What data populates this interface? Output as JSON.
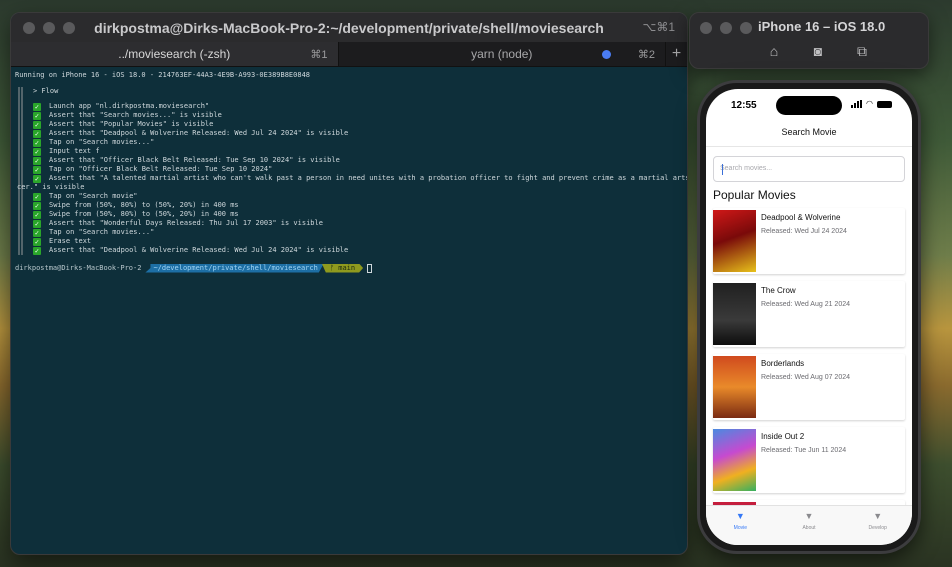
{
  "terminal": {
    "title": "dirkpostma@Dirks-MacBook-Pro-2:~/development/private/shell/moviesearch",
    "shortcut": "⌥⌘1",
    "tabs": [
      {
        "label": "../moviesearch (-zsh)",
        "shortcut": "⌘1"
      },
      {
        "label": "yarn (node)",
        "shortcut": "⌘2"
      }
    ],
    "run_line": "Running on iPhone 16 - iOS 18.0 - 214763EF-44A3-4E9B-A993-0E389B8E0848",
    "flow_header": "> Flow",
    "flow_lines": [
      "Launch app \"nl.dirkpostma.moviesearch\"",
      "Assert that \"Search movies...\" is visible",
      "Assert that \"Popular Movies\" is visible",
      "Assert that \"Deadpool & Wolverine Released: Wed Jul 24 2024\" is visible",
      "Tap on \"Search movies...\"",
      "Input text f",
      "Assert that \"Officer Black Belt Released: Tue Sep 10 2024\" is visible",
      "Tap on \"Officer Black Belt Released: Tue Sep 10 2024\"",
      "Assert that \"A talented martial artist who can't walk past a person in need unites with a probation officer to fight and prevent crime as a martial arts offi",
      "Tap on \"Search movie\"",
      "Swipe from (50%, 80%) to (50%, 20%) in 400 ms",
      "Swipe from (50%, 80%) to (50%, 20%) in 400 ms",
      "Assert that \"Wonderful Days Released: Thu Jul 17 2003\" is visible",
      "Tap on \"Search movies...\"",
      "Erase text",
      "Assert that \"Deadpool & Wolverine Released: Wed Jul 24 2024\" is visible"
    ],
    "wrap_continuation": "cer.\" is visible",
    "prompt": {
      "user": "dirkpostma@Dirks-MacBook-Pro-2",
      "path": "~/development/private/shell/moviesearch",
      "branch": "ᚠ main"
    }
  },
  "simulator": {
    "title": "iPhone 16 – iOS 18.0",
    "icons": [
      "home-icon",
      "screenshot-icon",
      "rotate-icon"
    ]
  },
  "phone": {
    "time": "12:55",
    "nav_title": "Search Movie",
    "search_placeholder": "Search movies...",
    "section_title": "Popular Movies",
    "movies": [
      {
        "title": "Deadpool & Wolverine",
        "date": "Released: Wed Jul 24 2024"
      },
      {
        "title": "The Crow",
        "date": "Released: Wed Aug 21 2024"
      },
      {
        "title": "Borderlands",
        "date": "Released: Wed Aug 07 2024"
      },
      {
        "title": "Inside Out 2",
        "date": "Released: Tue Jun 11 2024"
      }
    ],
    "tabs": [
      {
        "label": "Movie",
        "active": true
      },
      {
        "label": "About",
        "active": false
      },
      {
        "label": "Develop",
        "active": false
      }
    ],
    "accent_color": "#3478f6"
  }
}
